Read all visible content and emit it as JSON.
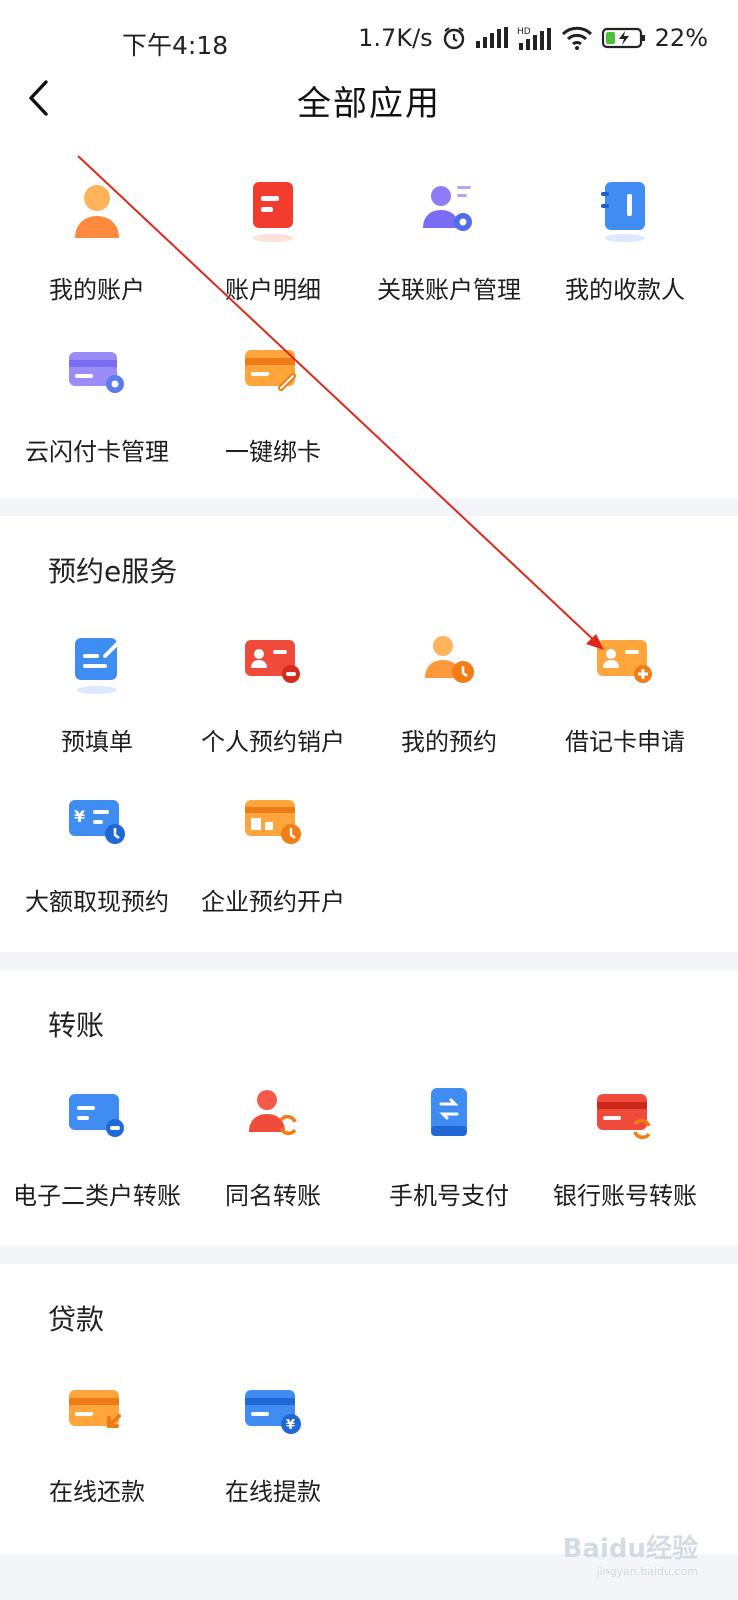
{
  "status_bar": {
    "time": "下午4:18",
    "net_speed": "1.7K/s",
    "battery": "22%"
  },
  "header": {
    "title": "全部应用",
    "back_icon": "chevron-left-icon"
  },
  "sections": [
    {
      "title": "",
      "items": [
        {
          "label": "我的账户",
          "icon": "person-icon",
          "color": "#ff8a3d"
        },
        {
          "label": "账户明细",
          "icon": "document-list-icon",
          "color": "#f23d2e"
        },
        {
          "label": "关联账户管理",
          "icon": "user-settings-icon",
          "color": "#7b6cf5"
        },
        {
          "label": "我的收款人",
          "icon": "contact-book-icon",
          "color": "#3f8cf2"
        },
        {
          "label": "云闪付卡管理",
          "icon": "card-settings-icon",
          "color": "#7b6cf5"
        },
        {
          "label": "一键绑卡",
          "icon": "card-link-icon",
          "color": "#ff8a1f"
        }
      ]
    },
    {
      "title": "预约e服务",
      "items": [
        {
          "label": "预填单",
          "icon": "form-pen-icon",
          "color": "#3f8cf2"
        },
        {
          "label": "个人预约销户",
          "icon": "id-card-minus-icon",
          "color": "#f04a3a"
        },
        {
          "label": "我的预约",
          "icon": "person-clock-icon",
          "color": "#ff9a3c"
        },
        {
          "label": "借记卡申请",
          "icon": "id-card-plus-icon",
          "color": "#ff9a3c"
        },
        {
          "label": "大额取现预约",
          "icon": "cash-clock-icon",
          "color": "#3f8cf2"
        },
        {
          "label": "企业预约开户",
          "icon": "building-clock-icon",
          "color": "#ff9a3c"
        }
      ]
    },
    {
      "title": "转账",
      "items": [
        {
          "label": "电子二类户转账",
          "icon": "card-minus-icon",
          "color": "#3f8cf2"
        },
        {
          "label": "同名转账",
          "icon": "person-exchange-icon",
          "color": "#f04a3a"
        },
        {
          "label": "手机号支付",
          "icon": "phone-exchange-icon",
          "color": "#3f8cf2"
        },
        {
          "label": "银行账号转账",
          "icon": "card-exchange-icon",
          "color": "#f04a3a"
        }
      ]
    },
    {
      "title": "贷款",
      "items": [
        {
          "label": "在线还款",
          "icon": "card-return-icon",
          "color": "#ff9a3c"
        },
        {
          "label": "在线提款",
          "icon": "card-yuan-icon",
          "color": "#3f8cf2"
        }
      ]
    }
  ],
  "watermark": {
    "text": "Baidu经验",
    "sub": "jingyan.baidu.com"
  }
}
